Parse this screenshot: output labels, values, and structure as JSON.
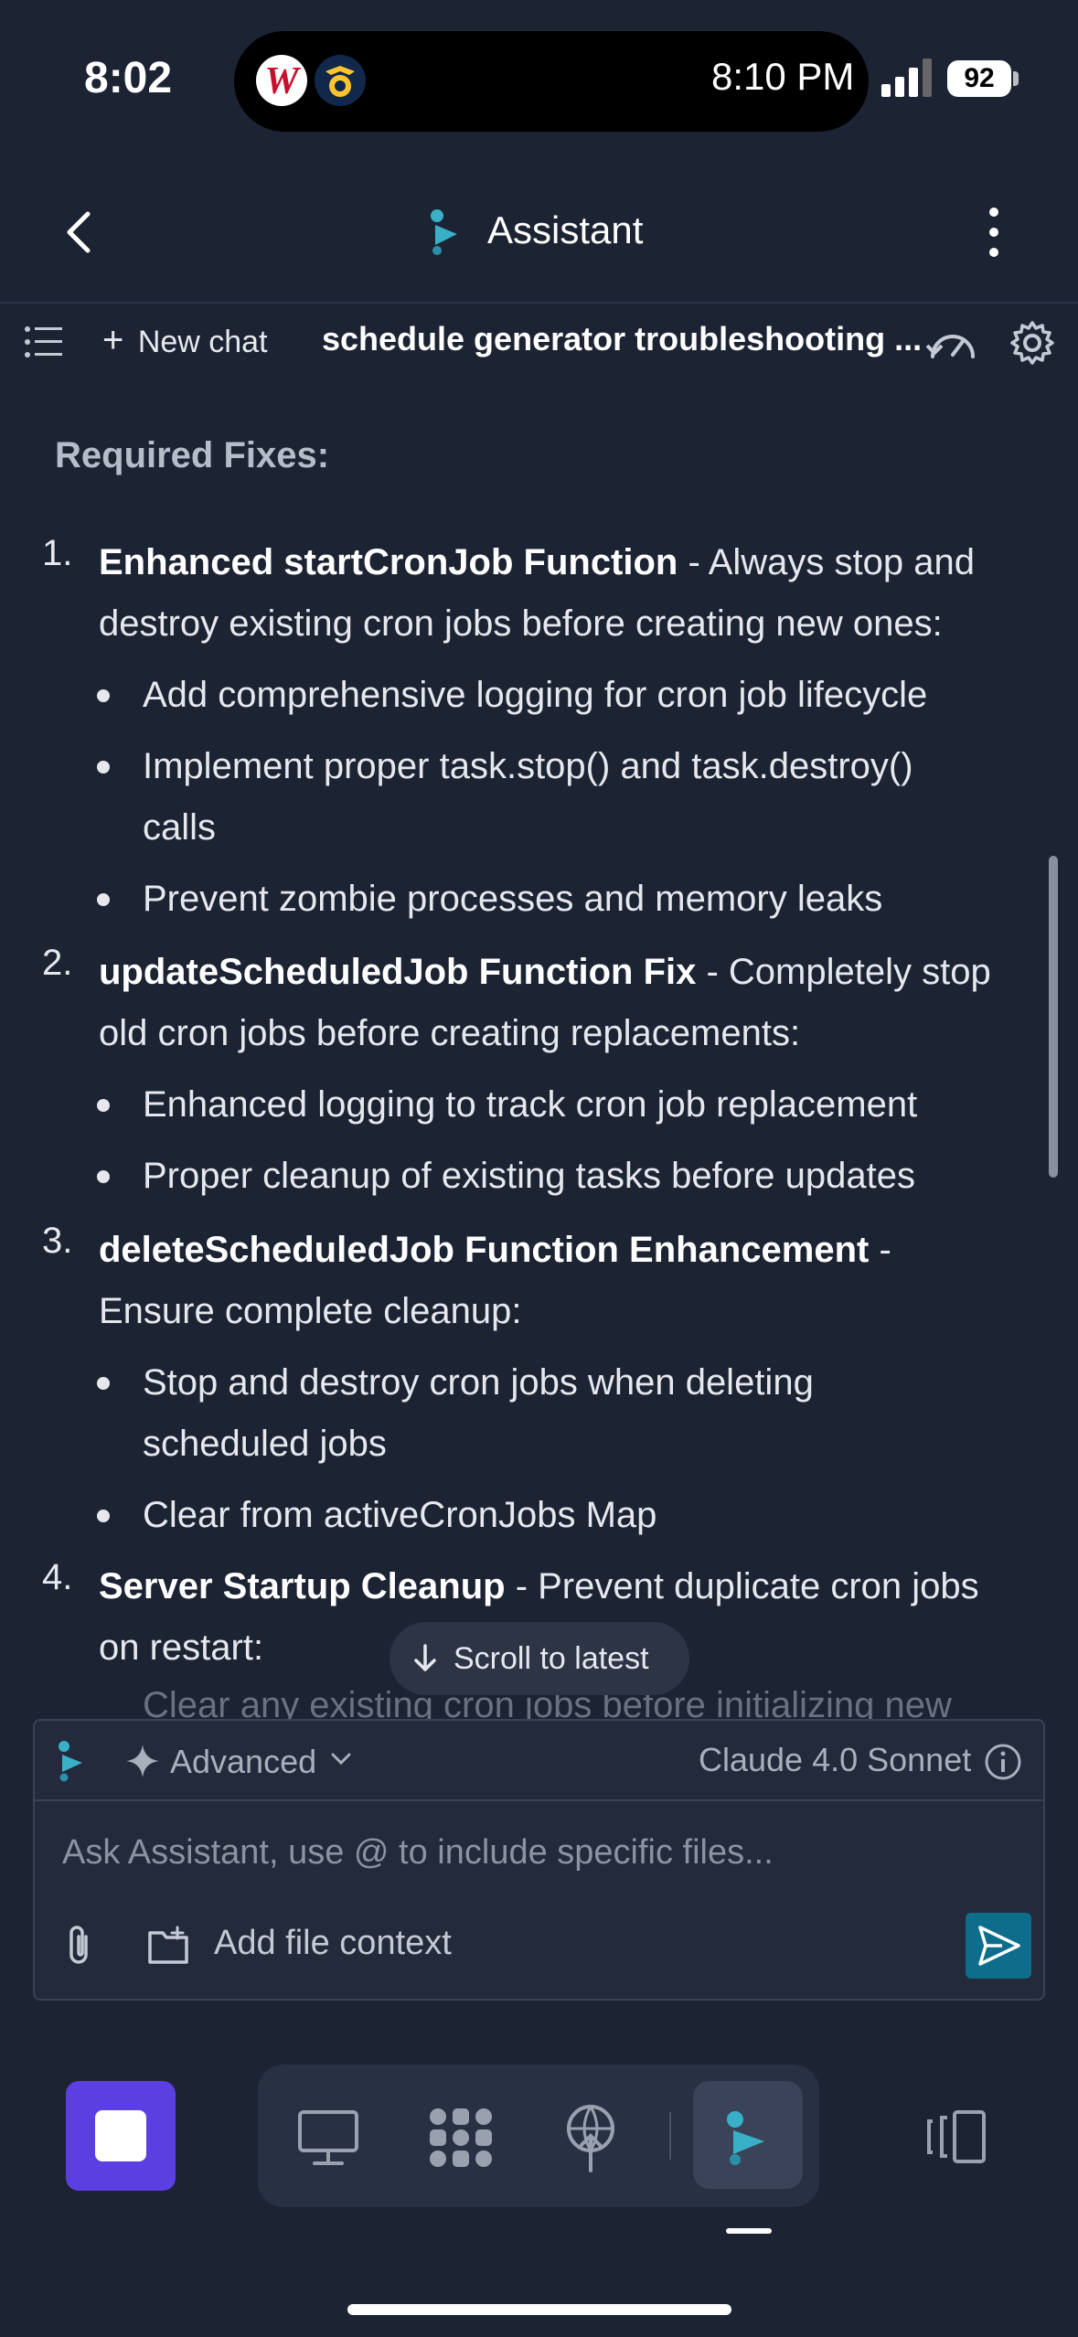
{
  "status_bar": {
    "time": "8:02",
    "island_time": "8:10 PM",
    "battery": "92"
  },
  "header": {
    "title": "Assistant"
  },
  "toolbar": {
    "new_chat": "New chat",
    "chat_title": "schedule generator troubleshooting ..."
  },
  "content": {
    "heading": "Required Fixes:",
    "items": [
      {
        "num": "1.",
        "bold": "Enhanced startCronJob Function",
        "text_line1": " - Always stop and",
        "text_line2": "destroy existing cron jobs before creating new ones:",
        "bullets": [
          {
            "line1": "Add comprehensive logging for cron job lifecycle"
          },
          {
            "line1": "Implement proper task.stop() and task.destroy()",
            "line2": "calls"
          },
          {
            "line1": "Prevent zombie processes and memory leaks"
          }
        ]
      },
      {
        "num": "2.",
        "bold": "updateScheduledJob Function Fix",
        "text_line1": " - Completely stop",
        "text_line2": "old cron jobs before creating replacements:",
        "bullets": [
          {
            "line1": "Enhanced logging to track cron job replacement"
          },
          {
            "line1": "Proper cleanup of existing tasks before updates"
          }
        ]
      },
      {
        "num": "3.",
        "bold": "deleteScheduledJob Function Enhancement",
        "text_line1": " -",
        "text_line2": "Ensure complete cleanup:",
        "bullets": [
          {
            "line1": "Stop and destroy cron jobs when deleting",
            "line2": "scheduled jobs"
          },
          {
            "line1": "Clear from activeCronJobs Map"
          }
        ]
      },
      {
        "num": "4.",
        "bold": "Server Startup Cleanup",
        "text_line1": " - Prevent duplicate cron jobs",
        "text_line2": "on restart:"
      }
    ],
    "clipped_line": "Clear any existing cron jobs before initializing new"
  },
  "scroll_to_latest": "Scroll to latest",
  "composer": {
    "mode": "Advanced",
    "model": "Claude 4.0 Sonnet",
    "placeholder": "Ask Assistant, use @ to include specific files...",
    "add_file_context": "Add file context"
  },
  "colors": {
    "background": "#1c2333",
    "stop_button": "#5b3fe0",
    "send_button": "#0d6d8a",
    "accent_teal": "#3ab0c8"
  },
  "icons": [
    "back-icon",
    "assistant-logo-icon",
    "more-icon",
    "list-icon",
    "plus-icon",
    "speed-icon",
    "gear-icon",
    "sparkle-icon",
    "chevron-down-icon",
    "info-icon",
    "paperclip-icon",
    "folder-plus-icon",
    "send-icon",
    "stop-icon",
    "monitor-icon",
    "apps-icon",
    "deploy-icon",
    "assistant-icon",
    "split-view-icon"
  ]
}
